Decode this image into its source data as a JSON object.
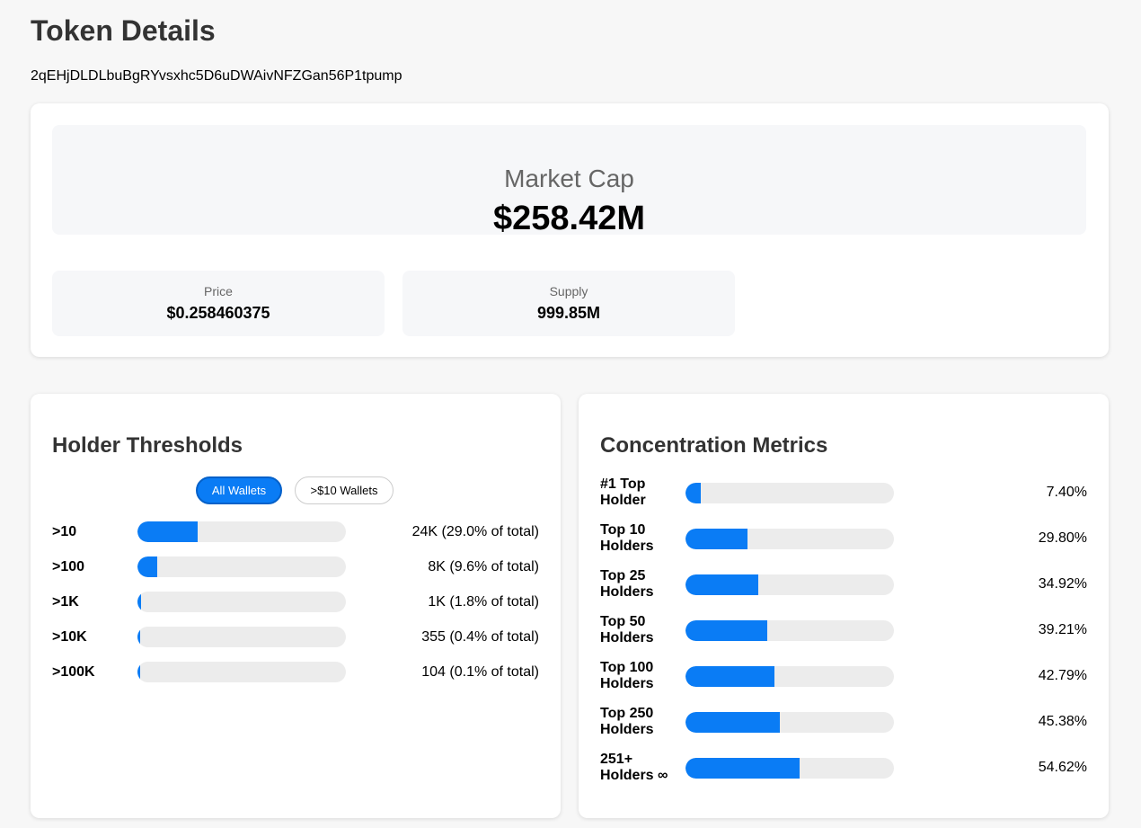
{
  "header": {
    "title": "Token Details",
    "address": "2qEHjDLDLbuBgRYvsxhc5D6uDWAivNFZGan56P1tpump"
  },
  "market_cap": {
    "label": "Market Cap",
    "value": "$258.42M"
  },
  "stats": {
    "price": {
      "label": "Price",
      "value": "$0.258460375"
    },
    "supply": {
      "label": "Supply",
      "value": "999.85M"
    }
  },
  "holder_thresholds": {
    "title": "Holder Thresholds",
    "toggles": {
      "all": "All Wallets",
      "over10": ">$10 Wallets",
      "selected": "All Wallets"
    },
    "rows": [
      {
        "label": ">10",
        "value": "24K (29.0% of total)",
        "fraction": 0.29
      },
      {
        "label": ">100",
        "value": "8K (9.6% of total)",
        "fraction": 0.096
      },
      {
        "label": ">1K",
        "value": "1K (1.8% of total)",
        "fraction": 0.018
      },
      {
        "label": ">10K",
        "value": "355 (0.4% of total)",
        "fraction": 0.004
      },
      {
        "label": ">100K",
        "value": "104 (0.1% of total)",
        "fraction": 0.001
      }
    ]
  },
  "concentration_metrics": {
    "title": "Concentration Metrics",
    "rows": [
      {
        "label_line1": "#1 Top",
        "label_line2": "Holder",
        "value": "7.40%",
        "fraction": 0.074
      },
      {
        "label_line1": "Top 10",
        "label_line2": "Holders",
        "value": "29.80%",
        "fraction": 0.298
      },
      {
        "label_line1": "Top 25",
        "label_line2": "Holders",
        "value": "34.92%",
        "fraction": 0.3492
      },
      {
        "label_line1": "Top 50",
        "label_line2": "Holders",
        "value": "39.21%",
        "fraction": 0.3921
      },
      {
        "label_line1": "Top 100",
        "label_line2": "Holders",
        "value": "42.79%",
        "fraction": 0.4279
      },
      {
        "label_line1": "Top 250",
        "label_line2": "Holders",
        "value": "45.38%",
        "fraction": 0.4538
      },
      {
        "label_line1": "251+",
        "label_line2": "Holders ∞",
        "value": "54.62%",
        "fraction": 0.5462
      }
    ]
  },
  "colors": {
    "accent": "#0a7cf5",
    "track": "#ececec",
    "title": "#333333"
  }
}
